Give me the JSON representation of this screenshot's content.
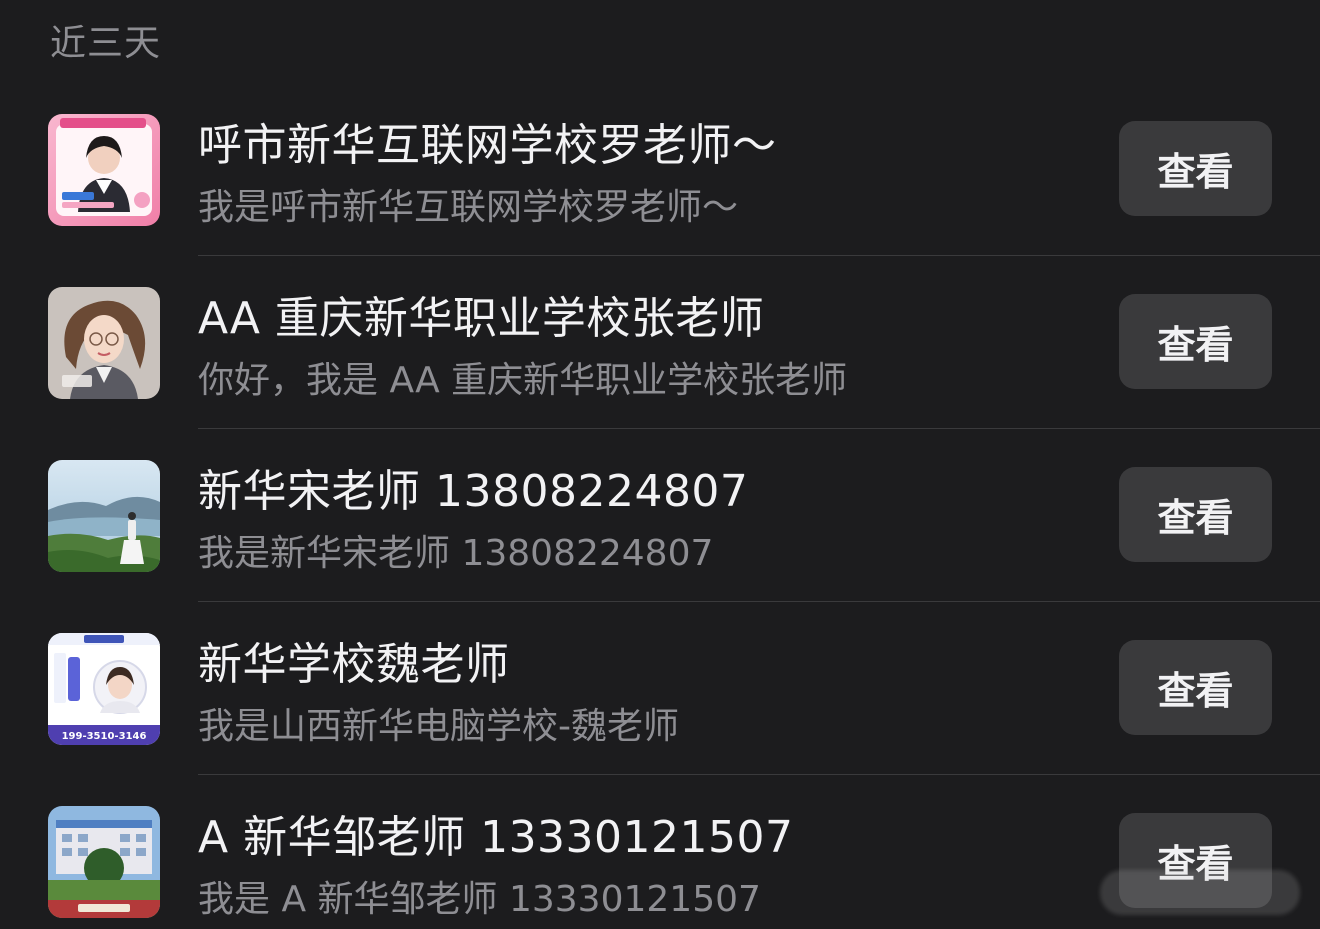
{
  "section": {
    "title": "近三天"
  },
  "contacts": [
    {
      "name": "呼市新华互联网学校罗老师～",
      "message": "我是呼市新华互联网学校罗老师～",
      "button": "查看",
      "avatar_icon": "teacher-card-pink"
    },
    {
      "name": "AA 重庆新华职业学校张老师",
      "message": "你好，我是 AA 重庆新华职业学校张老师",
      "button": "查看",
      "avatar_icon": "illustrated-woman"
    },
    {
      "name": "新华宋老师 13808224807",
      "message": "我是新华宋老师 13808224807",
      "button": "查看",
      "avatar_icon": "landscape-photo"
    },
    {
      "name": "新华学校魏老师",
      "message": "我是山西新华电脑学校-魏老师",
      "button": "查看",
      "avatar_icon": "career-planner-card",
      "avatar_text": "199-3510-3146"
    },
    {
      "name": "A 新华邹老师 13330121507",
      "message": "我是 A 新华邹老师 13330121507",
      "button": "查看",
      "avatar_icon": "school-building-photo"
    }
  ],
  "colors": {
    "background": "#1c1c1e",
    "button": "#3a3a3c",
    "primary_text": "#f2f2f4",
    "secondary_text": "#8e8e93"
  }
}
